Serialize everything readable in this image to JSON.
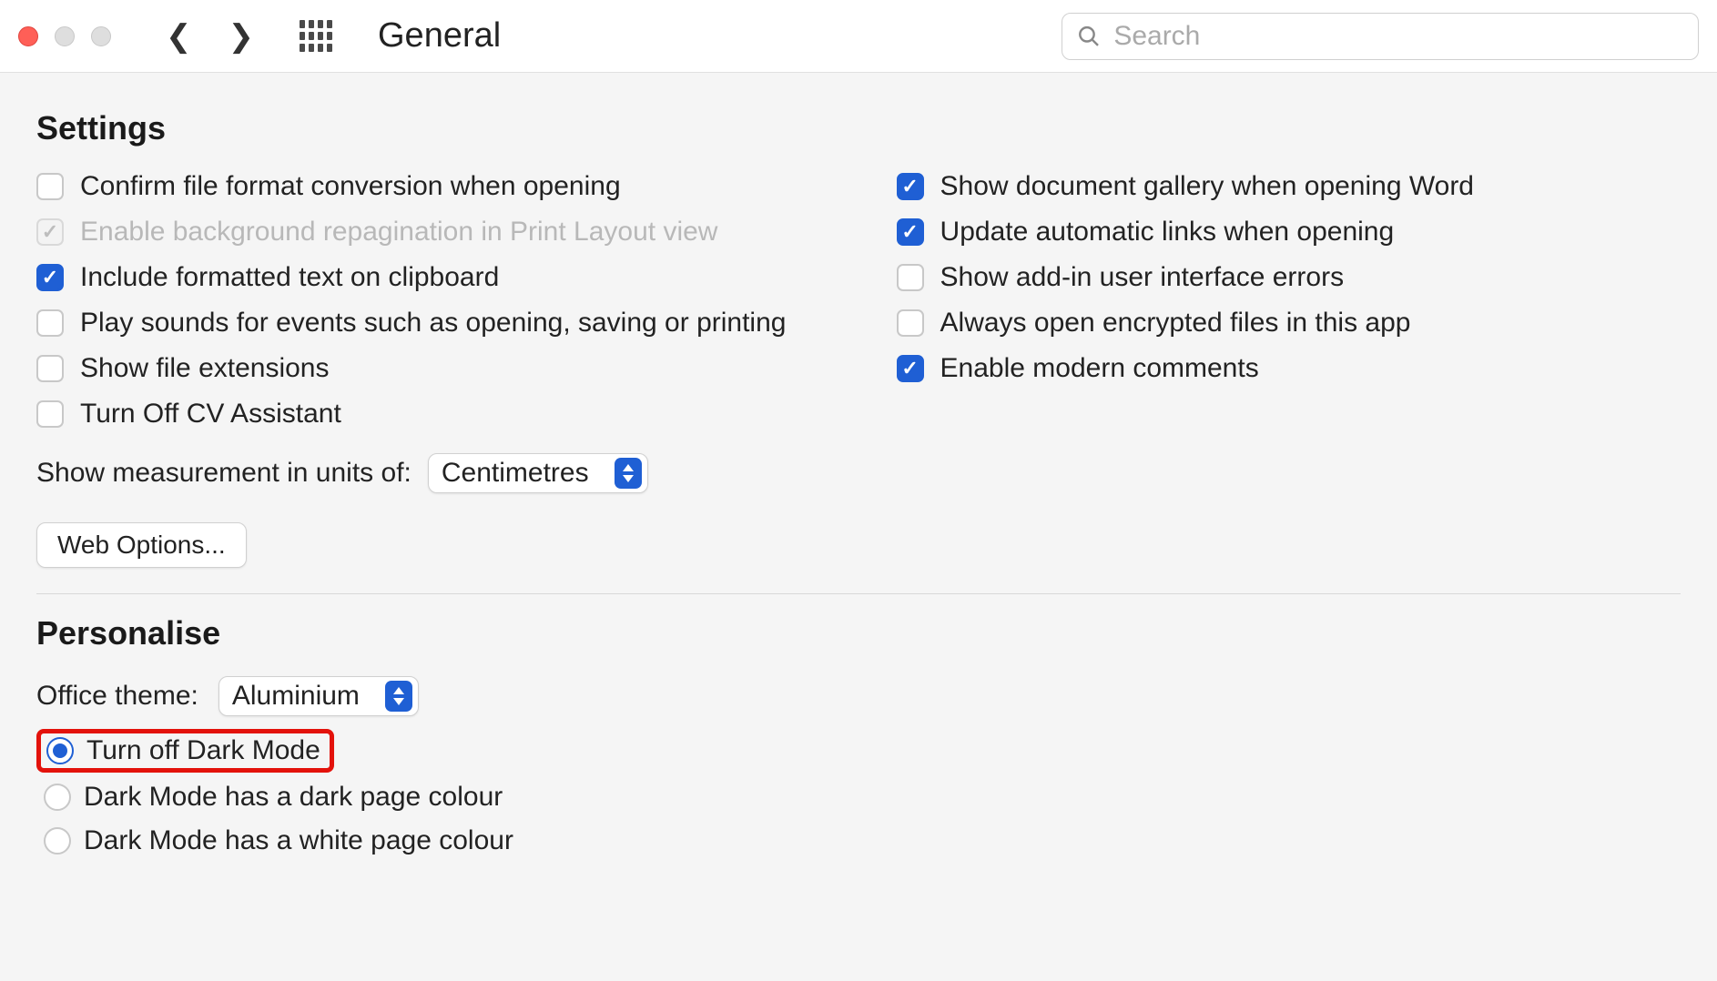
{
  "toolbar": {
    "title": "General",
    "search_placeholder": "Search"
  },
  "settings": {
    "heading": "Settings",
    "left": [
      {
        "label": "Confirm file format conversion when opening",
        "checked": false,
        "disabled": false
      },
      {
        "label": "Enable background repagination in Print Layout view",
        "checked": true,
        "disabled": true
      },
      {
        "label": "Include formatted text on clipboard",
        "checked": true,
        "disabled": false
      },
      {
        "label": "Play sounds for events such as opening, saving or printing",
        "checked": false,
        "disabled": false
      },
      {
        "label": "Show file extensions",
        "checked": false,
        "disabled": false
      },
      {
        "label": "Turn Off CV Assistant",
        "checked": false,
        "disabled": false
      }
    ],
    "right": [
      {
        "label": "Show document gallery when opening Word",
        "checked": true,
        "disabled": false
      },
      {
        "label": "Update automatic links when opening",
        "checked": true,
        "disabled": false
      },
      {
        "label": "Show add-in user interface errors",
        "checked": false,
        "disabled": false
      },
      {
        "label": "Always open encrypted files in this app",
        "checked": false,
        "disabled": false
      },
      {
        "label": "Enable modern comments",
        "checked": true,
        "disabled": false
      }
    ],
    "measurement_label": "Show measurement in units of:",
    "measurement_value": "Centimetres",
    "web_options_label": "Web Options..."
  },
  "personalise": {
    "heading": "Personalise",
    "theme_label": "Office theme:",
    "theme_value": "Aluminium",
    "radios": [
      {
        "label": "Turn off Dark Mode",
        "selected": true,
        "highlight": true
      },
      {
        "label": "Dark Mode has a dark page colour",
        "selected": false,
        "highlight": false
      },
      {
        "label": "Dark Mode has a white page colour",
        "selected": false,
        "highlight": false
      }
    ]
  }
}
